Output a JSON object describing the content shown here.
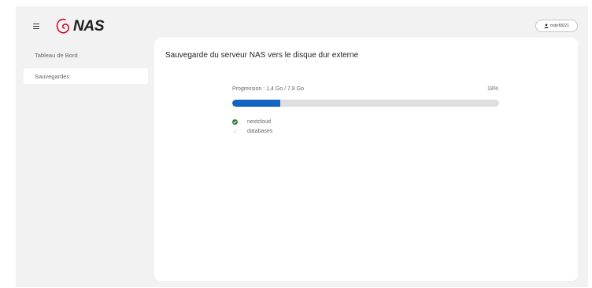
{
  "header": {
    "logo_text": "NAS",
    "user": {
      "name": "mdef0021",
      "icon": "user-icon"
    },
    "menu_icon": "hamburger-menu-icon"
  },
  "sidebar": {
    "items": [
      {
        "label": "Tableau de Bord",
        "active": false
      },
      {
        "label": "Sauvegardes",
        "active": true
      }
    ]
  },
  "main": {
    "title": "Sauvegarde du serveur NAS vers le disque dur externe",
    "progress": {
      "label": "Progression : 1,4 Go / 7,8 Go",
      "percent_text": "18%",
      "percent": 18,
      "color": "#1565c0"
    },
    "databases": [
      {
        "name": "nextcloud",
        "status": "done",
        "icon": "check-circle-icon"
      },
      {
        "name": "databases",
        "status": "pending",
        "icon": "check-icon"
      }
    ]
  },
  "colors": {
    "accent": "#1565c0",
    "success": "#2e7d32",
    "logo_swirl": "#c8102e"
  }
}
